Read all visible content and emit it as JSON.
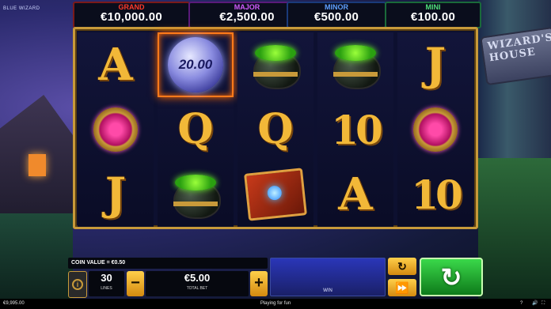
{
  "game": {
    "logo_text": "BLUE WIZARD",
    "sign_text": "WIZARD'S HOUSE"
  },
  "jackpots": [
    {
      "label": "GRAND",
      "value": "€10,000.00"
    },
    {
      "label": "MAJOR",
      "value": "€2,500.00"
    },
    {
      "label": "MINOR",
      "value": "€500.00"
    },
    {
      "label": "MINI",
      "value": "€100.00"
    }
  ],
  "reels": [
    [
      "A",
      "ring",
      "J"
    ],
    [
      "orb",
      "Q",
      "cauldron"
    ],
    [
      "cauldron",
      "Q",
      "book"
    ],
    [
      "cauldron",
      "10",
      "A"
    ],
    [
      "J",
      "ring",
      "10"
    ]
  ],
  "orb_value": "20.00",
  "controls": {
    "coin_value": "COIN VALUE = €0.50",
    "lines_value": "30",
    "lines_label": "LINES",
    "total_bet_value": "€5.00",
    "total_bet_label": "TOTAL BET",
    "minus": "−",
    "plus": "+",
    "win_label": "WIN",
    "info_icon": "i"
  },
  "status": {
    "balance": "€9,995.00",
    "mode": "Playing for fun",
    "help": "?"
  },
  "icons": [
    "info-icon",
    "autoplay-icon",
    "turbo-icon",
    "spin-icon",
    "sound-icon",
    "fullscreen-icon"
  ]
}
